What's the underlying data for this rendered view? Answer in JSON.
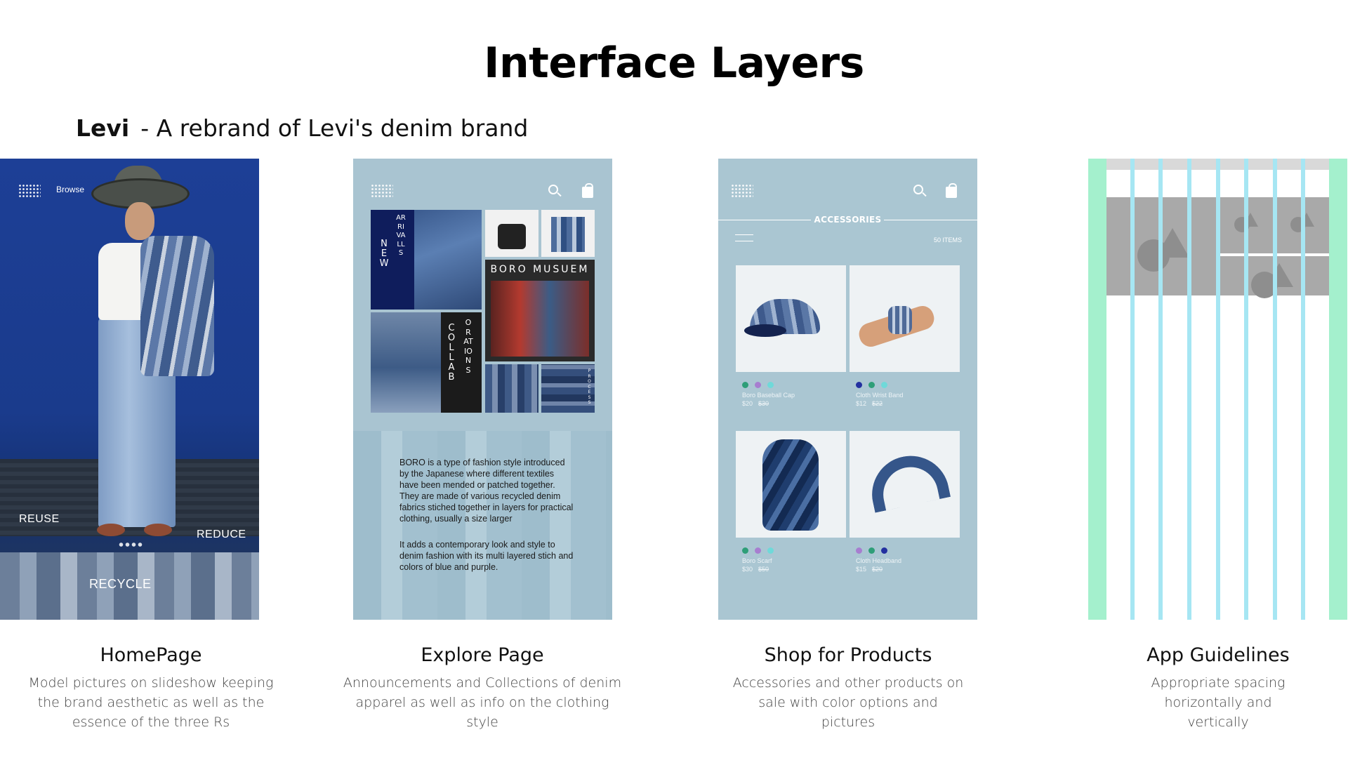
{
  "page": {
    "title": "Interface Layers",
    "subtitle_brand": "Levi",
    "subtitle_text": "- A rebrand of Levi's denim brand"
  },
  "home_screen": {
    "browse_label": "Browse",
    "labels": [
      "REUSE",
      "REDUCE",
      "RECYCLE"
    ]
  },
  "explore_screen": {
    "new_arrivals_left": "NEW",
    "new_arrivals_right": "ARRIVALLS",
    "collab_left": "COLLAB",
    "collab_right": "ORATIONS",
    "boro_title": "BORO MUSUEM",
    "process_label": "PROCESS",
    "paragraph_1": "BORO is a type of fashion style introduced by the Japanese where different textiles have been mended or patched together. They are made of various recycled denim fabrics stiched together in layers for practical clothing, usually a size larger",
    "paragraph_2": "It adds a contemporary look and style to denim fashion with its multi layered stich and colors of blue and purple."
  },
  "shop_screen": {
    "section_title": "ACCESSORIES",
    "item_count": "50 ITEMS",
    "products": [
      {
        "name": "Boro Baseball Cap",
        "price": "$20",
        "old_price": "$30",
        "swatches": [
          "#2e9e78",
          "#a77ed0",
          "#6fd9d9"
        ]
      },
      {
        "name": "Cloth Wrist Band",
        "price": "$12",
        "old_price": "$22",
        "swatches": [
          "#2330a0",
          "#2e9e78",
          "#6fd9d9"
        ]
      },
      {
        "name": "Boro Scarf",
        "price": "$30",
        "old_price": "$50",
        "swatches": [
          "#2e9e78",
          "#a77ed0",
          "#6fd9d9"
        ]
      },
      {
        "name": "Cloth Headband",
        "price": "$15",
        "old_price": "$20",
        "swatches": [
          "#a77ed0",
          "#2e9e78",
          "#2330a0"
        ]
      }
    ]
  },
  "captions": [
    {
      "title": "HomePage",
      "desc": "Model pictures on slideshow keeping the brand aesthetic as well as the essence of the three Rs"
    },
    {
      "title": "Explore Page",
      "desc": "Announcements and Collections of denim apparel as well as info on the clothing style"
    },
    {
      "title": "Shop for Products",
      "desc": "Accessories and other products on sale with color options and pictures"
    },
    {
      "title": "App Guidelines",
      "desc": "Appropriate spacing horizontally and vertically"
    }
  ],
  "colors": {
    "home_bg": "#1d3f96",
    "explore_bg": "#a9c4d1",
    "shop_bg": "#aac6d2",
    "grid_margin": "#a4f0cd",
    "grid_column": "#a6e6f3",
    "grid_block": "#a9a9a9",
    "new_arrivals_tile": "#0f1d5c"
  },
  "icons": [
    "menu-dots-icon",
    "search-icon",
    "shopping-bag-icon",
    "back-arrow-icon",
    "placeholder-image-icon"
  ]
}
